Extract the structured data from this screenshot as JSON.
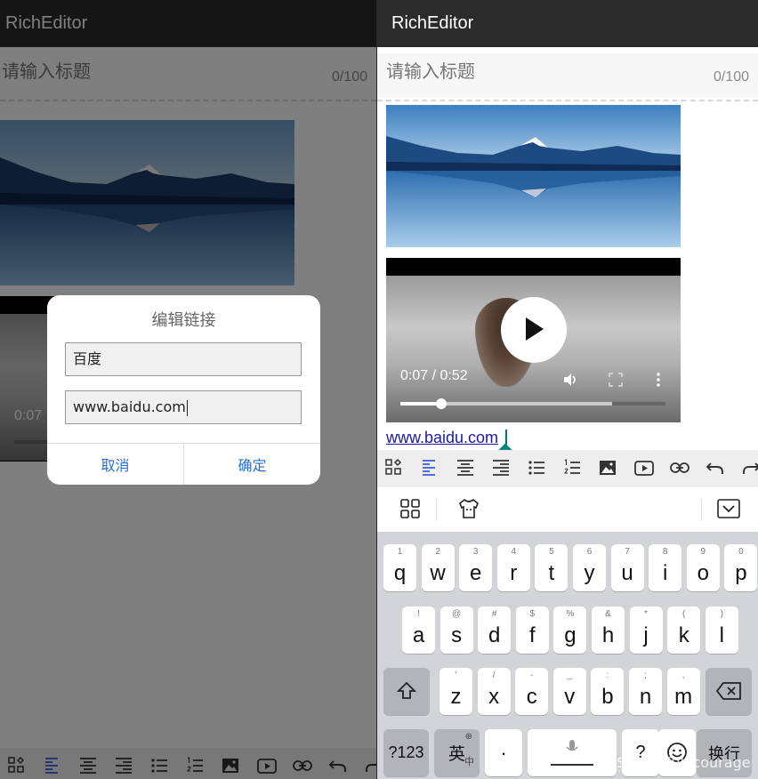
{
  "app": {
    "title": "RichEditor"
  },
  "editor": {
    "title_placeholder": "请输入标题",
    "title_counter": "0/100"
  },
  "video": {
    "time": "0:07 / 0:52",
    "left_time": "0:07",
    "played_fraction": 0.155,
    "buffered_fraction": 0.8
  },
  "content": {
    "link_text": "www.baidu.com"
  },
  "toolbar": {
    "items": [
      "grid-icon",
      "align-left-icon",
      "align-center-icon",
      "align-right-icon",
      "bullet-list-icon",
      "numbered-list-icon",
      "image-icon",
      "video-icon",
      "link-icon",
      "undo-icon",
      "redo-icon"
    ],
    "active_color": "#3b5bdb"
  },
  "dialog": {
    "title": "编辑链接",
    "name_value": "百度",
    "url_value": "www.baidu.com",
    "cancel_label": "取消",
    "confirm_label": "确定"
  },
  "keyboard": {
    "row1": [
      {
        "hint": "1",
        "key": "q"
      },
      {
        "hint": "2",
        "key": "w"
      },
      {
        "hint": "3",
        "key": "e"
      },
      {
        "hint": "4",
        "key": "r"
      },
      {
        "hint": "5",
        "key": "t"
      },
      {
        "hint": "6",
        "key": "y"
      },
      {
        "hint": "7",
        "key": "u"
      },
      {
        "hint": "8",
        "key": "i"
      },
      {
        "hint": "9",
        "key": "o"
      },
      {
        "hint": "0",
        "key": "p"
      }
    ],
    "row2": [
      {
        "hint": "!",
        "key": "a"
      },
      {
        "hint": "@",
        "key": "s"
      },
      {
        "hint": "#",
        "key": "d"
      },
      {
        "hint": "$",
        "key": "f"
      },
      {
        "hint": "%",
        "key": "g"
      },
      {
        "hint": "&",
        "key": "h"
      },
      {
        "hint": "*",
        "key": "j"
      },
      {
        "hint": "(",
        "key": "k"
      },
      {
        "hint": ")",
        "key": "l"
      }
    ],
    "row3": [
      {
        "hint": "'",
        "key": "z"
      },
      {
        "hint": "/",
        "key": "x"
      },
      {
        "hint": "-",
        "key": "c"
      },
      {
        "hint": "_",
        "key": "v"
      },
      {
        "hint": ":",
        "key": "b"
      },
      {
        "hint": ";",
        "key": "n"
      },
      {
        "hint": ",",
        "key": "m"
      }
    ],
    "sym_label": "?123",
    "lang_label": "英",
    "lang_sub": "中",
    "dot_label": "·",
    "question_label": "?",
    "enter_label": "换行"
  },
  "watermark": "CSDN @full courage"
}
